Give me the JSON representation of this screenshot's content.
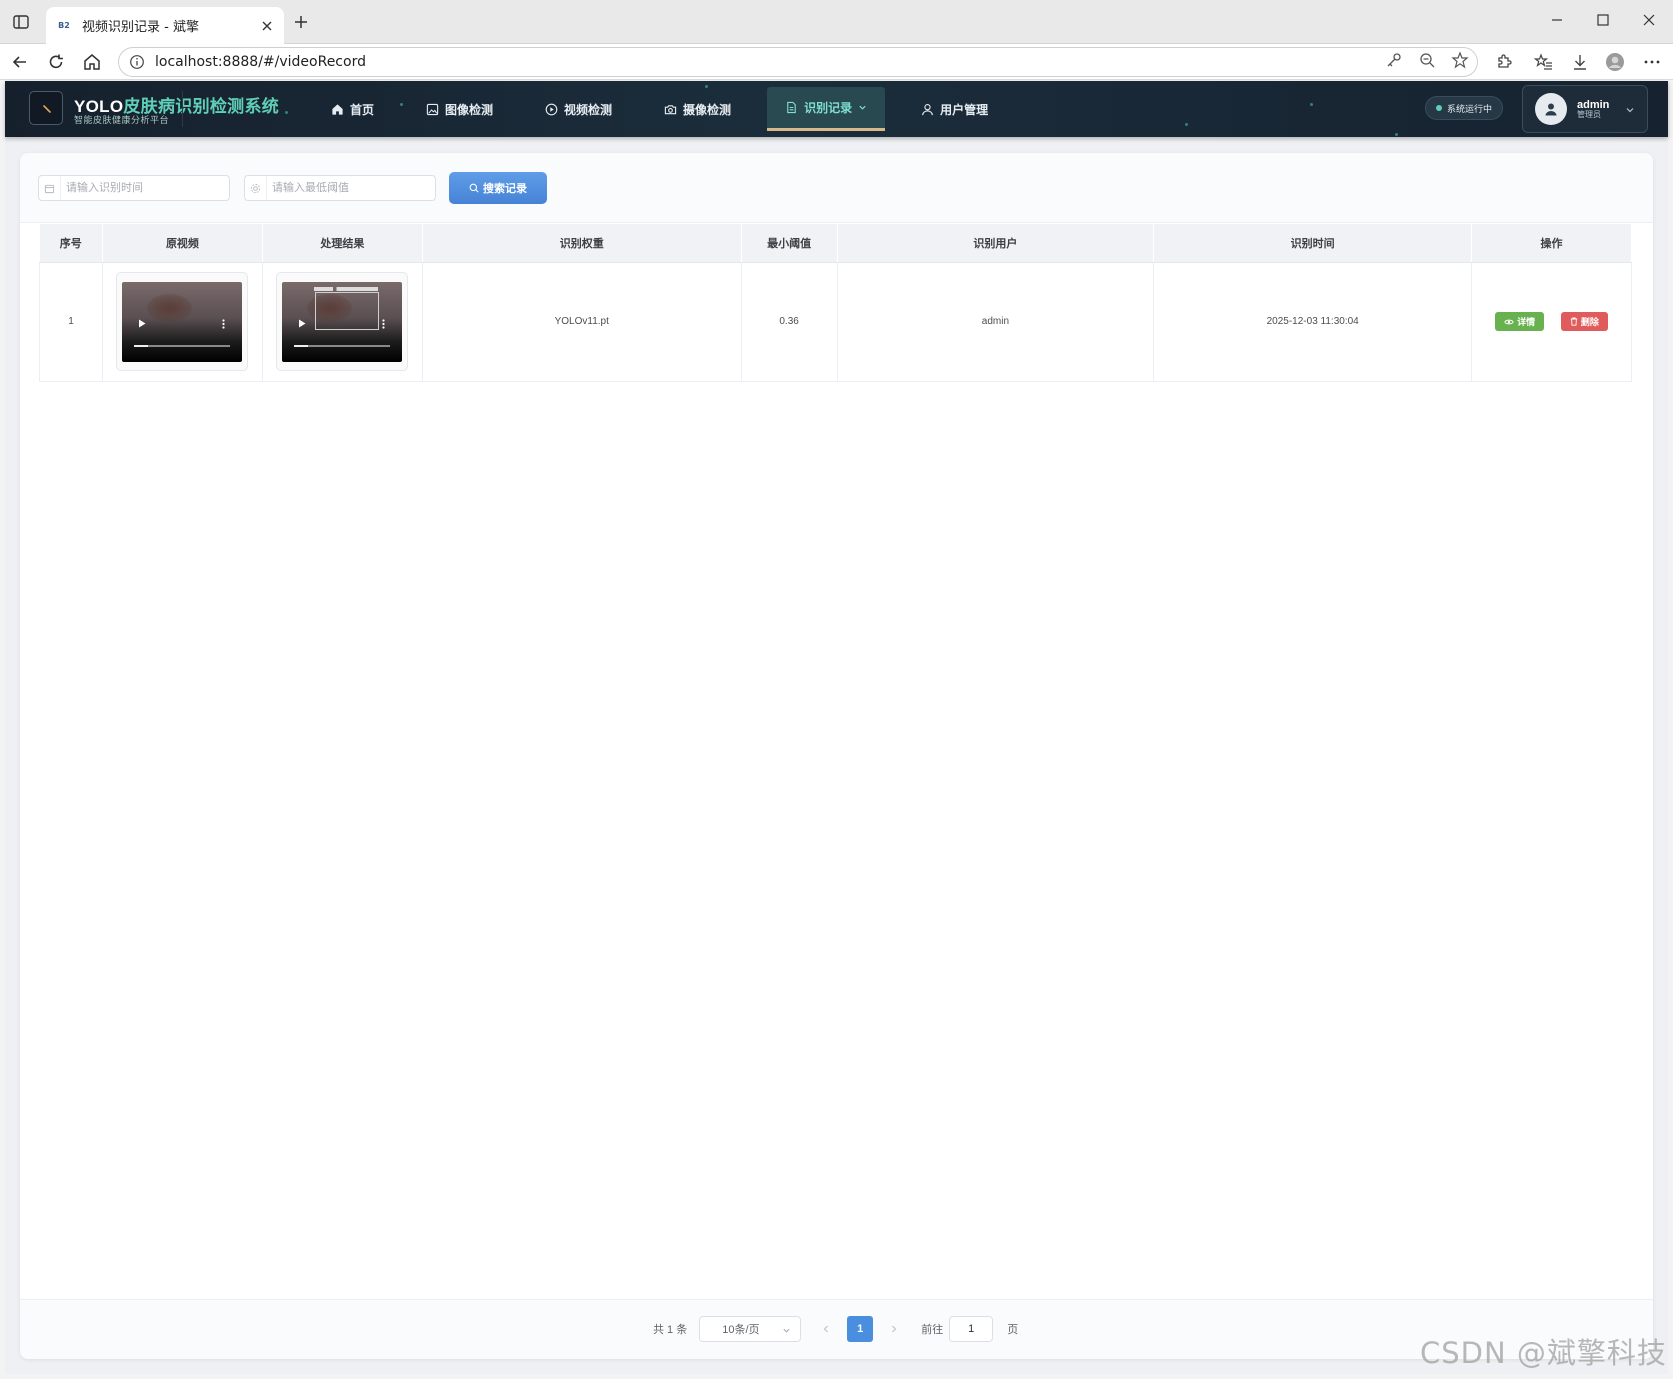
{
  "browser": {
    "tab_title": "视频识别记录 - 斌擎",
    "favicon_text": "B2",
    "url": "localhost:8888/#/videoRecord"
  },
  "header": {
    "brand_title_main": "YOLO",
    "brand_title_rest": "皮肤病识别检测系统",
    "brand_subtitle": "智能皮肤健康分析平台",
    "nav": [
      {
        "label": "首页",
        "icon": "home-icon"
      },
      {
        "label": "图像检测",
        "icon": "image-icon"
      },
      {
        "label": "视频检测",
        "icon": "play-circle-icon"
      },
      {
        "label": "摄像检测",
        "icon": "camera-icon"
      },
      {
        "label": "识别记录",
        "icon": "document-icon",
        "active": true
      },
      {
        "label": "用户管理",
        "icon": "user-icon"
      }
    ],
    "status_label": "系统运行中",
    "user_name": "admin",
    "user_role": "管理员"
  },
  "filters": {
    "time_placeholder": "请输入识别时间",
    "threshold_placeholder": "请输入最低阈值",
    "search_label": "搜索记录"
  },
  "table": {
    "columns": [
      "序号",
      "原视频",
      "处理结果",
      "识别权重",
      "最小阈值",
      "识别用户",
      "识别时间",
      "操作"
    ],
    "rows": [
      {
        "index": "1",
        "weight": "YOLOv11.pt",
        "threshold": "0.36",
        "user": "admin",
        "time": "2025-12-03 11:30:04",
        "detail_label": "详情",
        "delete_label": "删除"
      }
    ]
  },
  "pagination": {
    "total": "共 1 条",
    "page_size": "10条/页",
    "current_page": "1",
    "goto_label": "前往",
    "goto_value": "1",
    "page_suffix": "页"
  },
  "watermark": "CSDN @斌擎科技",
  "colors": {
    "header_bg": "#16202d",
    "accent_teal": "#5fd0b7",
    "primary": "#4a8ee0",
    "success": "#67b24e",
    "danger": "#e05c5c"
  }
}
